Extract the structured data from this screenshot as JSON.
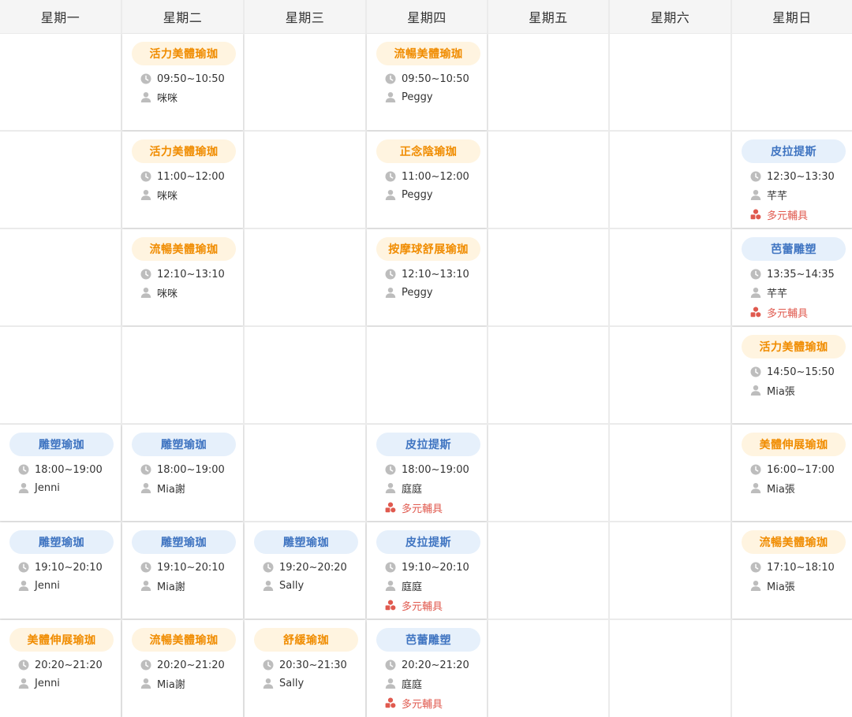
{
  "days": [
    "星期一",
    "星期二",
    "星期三",
    "星期四",
    "星期五",
    "星期六",
    "星期日"
  ],
  "slots": 7,
  "colors": {
    "orange_bg": "#fff4e0",
    "orange_text": "#f08c00",
    "blue_bg": "#e6f0fb",
    "blue_text": "#3f74c1",
    "equipment_text": "#e05a4f",
    "icon_gray": "#bdbdbd"
  },
  "icons": {
    "time": "clock-icon",
    "instructor": "person-icon",
    "equipment": "props-icon"
  },
  "classes": [
    {
      "day": 1,
      "slot": 0,
      "name": "活力美體瑜珈",
      "style": "orange",
      "time": "09:50~10:50",
      "instructor": "咪咪"
    },
    {
      "day": 3,
      "slot": 0,
      "name": "流暢美體瑜珈",
      "style": "orange",
      "time": "09:50~10:50",
      "instructor": "Peggy"
    },
    {
      "day": 1,
      "slot": 1,
      "name": "活力美體瑜珈",
      "style": "orange",
      "time": "11:00~12:00",
      "instructor": "咪咪"
    },
    {
      "day": 3,
      "slot": 1,
      "name": "正念陰瑜珈",
      "style": "orange",
      "time": "11:00~12:00",
      "instructor": "Peggy"
    },
    {
      "day": 6,
      "slot": 1,
      "name": "皮拉提斯",
      "style": "blue",
      "time": "12:30~13:30",
      "instructor": "芊芊",
      "equipment": "多元輔具"
    },
    {
      "day": 1,
      "slot": 2,
      "name": "流暢美體瑜珈",
      "style": "orange",
      "time": "12:10~13:10",
      "instructor": "咪咪"
    },
    {
      "day": 3,
      "slot": 2,
      "name": "按摩球舒展瑜珈",
      "style": "orange",
      "time": "12:10~13:10",
      "instructor": "Peggy"
    },
    {
      "day": 6,
      "slot": 2,
      "name": "芭蕾雕塑",
      "style": "blue",
      "time": "13:35~14:35",
      "instructor": "芊芊",
      "equipment": "多元輔具"
    },
    {
      "day": 6,
      "slot": 3,
      "name": "活力美體瑜珈",
      "style": "orange",
      "time": "14:50~15:50",
      "instructor": "Mia張"
    },
    {
      "day": 0,
      "slot": 4,
      "name": "雕塑瑜珈",
      "style": "blue",
      "time": "18:00~19:00",
      "instructor": "Jenni"
    },
    {
      "day": 1,
      "slot": 4,
      "name": "雕塑瑜珈",
      "style": "blue",
      "time": "18:00~19:00",
      "instructor": "Mia謝"
    },
    {
      "day": 3,
      "slot": 4,
      "name": "皮拉提斯",
      "style": "blue",
      "time": "18:00~19:00",
      "instructor": "庭庭",
      "equipment": "多元輔具"
    },
    {
      "day": 6,
      "slot": 4,
      "name": "美體伸展瑜珈",
      "style": "orange",
      "time": "16:00~17:00",
      "instructor": "Mia張"
    },
    {
      "day": 0,
      "slot": 5,
      "name": "雕塑瑜珈",
      "style": "blue",
      "time": "19:10~20:10",
      "instructor": "Jenni"
    },
    {
      "day": 1,
      "slot": 5,
      "name": "雕塑瑜珈",
      "style": "blue",
      "time": "19:10~20:10",
      "instructor": "Mia謝"
    },
    {
      "day": 2,
      "slot": 5,
      "name": "雕塑瑜珈",
      "style": "blue",
      "time": "19:20~20:20",
      "instructor": "Sally"
    },
    {
      "day": 3,
      "slot": 5,
      "name": "皮拉提斯",
      "style": "blue",
      "time": "19:10~20:10",
      "instructor": "庭庭",
      "equipment": "多元輔具"
    },
    {
      "day": 6,
      "slot": 5,
      "name": "流暢美體瑜珈",
      "style": "orange",
      "time": "17:10~18:10",
      "instructor": "Mia張"
    },
    {
      "day": 0,
      "slot": 6,
      "name": "美體伸展瑜珈",
      "style": "orange",
      "time": "20:20~21:20",
      "instructor": "Jenni"
    },
    {
      "day": 1,
      "slot": 6,
      "name": "流暢美體瑜珈",
      "style": "orange",
      "time": "20:20~21:20",
      "instructor": "Mia謝"
    },
    {
      "day": 2,
      "slot": 6,
      "name": "舒緩瑜珈",
      "style": "orange",
      "time": "20:30~21:30",
      "instructor": "Sally"
    },
    {
      "day": 3,
      "slot": 6,
      "name": "芭蕾雕塑",
      "style": "blue",
      "time": "20:20~21:20",
      "instructor": "庭庭",
      "equipment": "多元輔具"
    }
  ]
}
